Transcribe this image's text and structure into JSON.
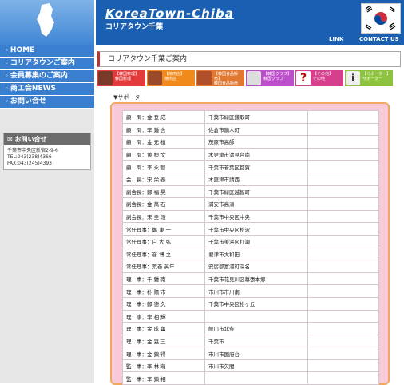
{
  "header": {
    "title": "KoreaTown-Chiba",
    "subtitle": "コリアタウン千葉",
    "nav": [
      "LINK",
      "CONTACT US"
    ]
  },
  "sidebar": {
    "menu": [
      "HOME",
      "コリアタウンご案内",
      "会員募集のご案内",
      "商工会NEWS",
      "お問い合せ"
    ],
    "contact": {
      "heading": "お問い合せ",
      "lines": [
        "千葉市中央区新宿2-9-6",
        "TEL:043(238)4366",
        "FAX:043(245)4393"
      ]
    }
  },
  "main": {
    "title": "コリアタウン千葉ご案内",
    "categories": [
      {
        "label": "【韓国料理】",
        "sub": "韓国料理",
        "color": "#e33b3b"
      },
      {
        "label": "【焼肉店】",
        "sub": "焼肉店",
        "color": "#f08a1c"
      },
      {
        "label": "【韓国食品販売】",
        "sub": "韓国食品販売",
        "color": "#e07832"
      },
      {
        "label": "【韓国クラブ】",
        "sub": "韓国クラブ",
        "color": "#bb4fc9"
      },
      {
        "label": "【その他】",
        "sub": "その他",
        "color": "#d63f8c"
      },
      {
        "label": "【サポーター】",
        "sub": "サポーター",
        "color": "#8dc33e"
      }
    ],
    "section": "▼サポーター",
    "rows": [
      {
        "name": "顧　問：金 登 成",
        "addr": "千葉市緑区鎌取町"
      },
      {
        "name": "顧　問：李 鍾 舎",
        "addr": "佐倉市鏑木町"
      },
      {
        "name": "顧　問：金 元 植",
        "addr": "茂原市高師"
      },
      {
        "name": "顧　問：黄 桓 文",
        "addr": "木更津市清見台南"
      },
      {
        "name": "顧　問：李 永 智",
        "addr": "千葉市若葉区都賀"
      },
      {
        "name": "会　長：宋 栄 泰",
        "addr": "木更津市請西"
      },
      {
        "name": "副会長：鄭 福 晃",
        "addr": "千葉市緑区越智町"
      },
      {
        "name": "副会長：金 萬 石",
        "addr": "浦安市高洲"
      },
      {
        "name": "副会長：宋 圭 浩",
        "addr": "千葉市中央区中央"
      },
      {
        "name": "常任理事：鄭 東 一",
        "addr": "千葉市中央区松波"
      },
      {
        "name": "常任理事：白 大 弘",
        "addr": "千葉市美浜区打瀬"
      },
      {
        "name": "常任理事：崔 博 之",
        "addr": "君津市大和田"
      },
      {
        "name": "常任理事：荒巻 英年",
        "addr": "安房郡富浦町深名"
      },
      {
        "name": "理　事：千 鍾 南",
        "addr": "千葉市花見川区幕張本郷"
      },
      {
        "name": "理　事：朴 陽 市",
        "addr": "市川市市川南"
      },
      {
        "name": "理　事：鄭 德 久",
        "addr": "千葉市中央区松ヶ丘"
      },
      {
        "name": "理　事：李 相 輝",
        "addr": ""
      },
      {
        "name": "理　事：金 成 亀",
        "addr": "館山市北条"
      },
      {
        "name": "理　事：金 晃 三",
        "addr": "千葉市"
      },
      {
        "name": "理　事：金 鎮 得",
        "addr": "市川市国府台"
      },
      {
        "name": "監　事：李 林 萌",
        "addr": "市川市欠間"
      },
      {
        "name": "監　事：李 鎮 相",
        "addr": ""
      }
    ]
  }
}
